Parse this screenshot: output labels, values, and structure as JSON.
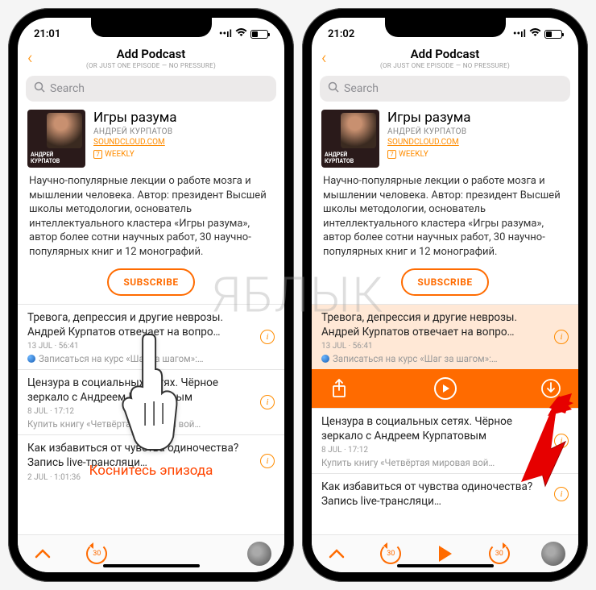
{
  "watermark": "ЯБЛЫК",
  "phones": [
    {
      "time": "21:01",
      "nav": {
        "title": "Add Podcast",
        "subtitle": "(OR JUST ONE EPISODE — NO PRESSURE)"
      },
      "search": {
        "placeholder": "Search"
      },
      "podcast": {
        "cover_label": "АНДРЕЙ КУРПАТОВ",
        "title": "Игры разума",
        "author": "АНДРЕЙ КУРПАТОВ",
        "source": "SOUNDCLOUD.COM",
        "frequency_badge": "7",
        "frequency": "WEEKLY",
        "description": "Научно-популярные лекции о работе мозга и мышлении человека. Автор: президент Высшей школы методологии, основатель интеллектуального кластера «Игры разума», автор более сотни научных работ, 30 научно-популярных книг и 12 монографий.",
        "subscribe": "SUBSCRIBE"
      },
      "episodes": [
        {
          "title": "Тревога, депрессия и другие неврозы. Андрей Курпатов отвечает на вопро…",
          "meta": "13 JUL · 56:41",
          "sub": "Записаться на курс «Шаг за шагом»:…",
          "blue": true
        },
        {
          "title": "Цензура в социальных сетях. Чёрное зеркало с Андреем Курпатовым",
          "meta": "8 JUL · 17:12",
          "sub": "Купить книгу «Четвёртая мировая вой…",
          "blue": false
        },
        {
          "title": "Как избавиться от чувства одиночества? Запись live-трансляци…",
          "meta": "2 JUL · 1:01:36",
          "sub": "",
          "blue": false
        }
      ],
      "bottom": {
        "skip": "30"
      },
      "instruction": "Коснитесь эпизода"
    },
    {
      "time": "21:02",
      "nav": {
        "title": "Add Podcast",
        "subtitle": "(OR JUST ONE EPISODE — NO PRESSURE)"
      },
      "search": {
        "placeholder": "Search"
      },
      "podcast": {
        "cover_label": "АНДРЕЙ КУРПАТОВ",
        "title": "Игры разума",
        "author": "АНДРЕЙ КУРПАТОВ",
        "source": "SOUNDCLOUD.COM",
        "frequency_badge": "7",
        "frequency": "WEEKLY",
        "description": "Научно-популярные лекции о работе мозга и мышлении человека. Автор: президент Высшей школы методологии, основатель интеллектуального кластера «Игры разума», автор более сотни научных работ, 30 научно-популярных книг и 12 монографий.",
        "subscribe": "SUBSCRIBE"
      },
      "episodes": [
        {
          "title": "Тревога, депрессия и другие неврозы. Андрей Курпатов отвечает на вопро…",
          "meta": "13 JUL · 56:41",
          "sub": "Записаться на курс «Шаг за шагом»:…",
          "blue": true,
          "highlighted": true,
          "actions": true
        },
        {
          "title": "Цензура в социальных сетях. Чёрное зеркало с Андреем Курпатовым",
          "meta": "8 JUL · 17:12",
          "sub": "Купить книгу «Четвёртая мировая вой…",
          "blue": false
        },
        {
          "title": "Как избавиться от чувства одиночества? Запись live-трансляци…",
          "meta": "",
          "sub": "",
          "blue": false
        }
      ],
      "bottom": {
        "skip": "30"
      }
    }
  ]
}
